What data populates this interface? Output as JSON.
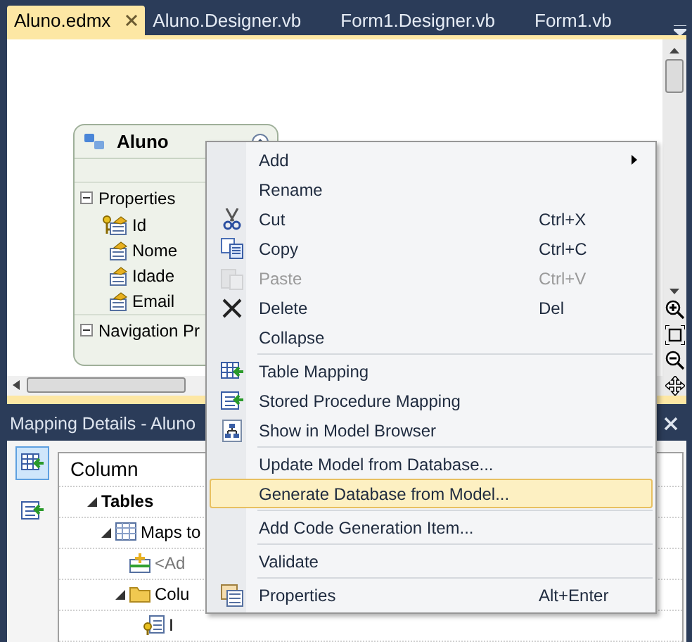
{
  "tabs": [
    {
      "label": "Aluno.edmx",
      "selected": true
    },
    {
      "label": "Aluno.Designer.vb",
      "selected": false
    },
    {
      "label": "Form1.Designer.vb",
      "selected": false
    },
    {
      "label": "Form1.vb",
      "selected": false
    }
  ],
  "entity": {
    "title": "Aluno",
    "sections": [
      {
        "label": "Properties",
        "expanded": true,
        "items": [
          {
            "name": "Id",
            "key": true
          },
          {
            "name": "Nome",
            "key": false
          },
          {
            "name": "Idade",
            "key": false
          },
          {
            "name": "Email",
            "key": false
          }
        ]
      },
      {
        "label": "Navigation Pr",
        "expanded": true
      }
    ]
  },
  "mapping_panel": {
    "title": "Mapping Details - Aluno",
    "tools": [
      {
        "kind": "table",
        "selected": true
      },
      {
        "kind": "procedure",
        "selected": false
      }
    ],
    "column_header": "Column",
    "rows": [
      {
        "label": "Tables",
        "kind": "group",
        "expanded": true,
        "children": [
          {
            "label": "Maps to",
            "kind": "table",
            "expanded": true,
            "children": [
              {
                "label": "<Ad",
                "kind": "add"
              },
              {
                "label": "Colu",
                "kind": "folder",
                "expanded": true,
                "children": [
                  {
                    "label": "I",
                    "kind": "key"
                  }
                ]
              }
            ]
          }
        ]
      }
    ]
  },
  "context_menu": [
    {
      "label": "Add",
      "kind": "plain",
      "submenu": true,
      "disabled": false,
      "selected": false,
      "separator_before": false
    },
    {
      "label": "Rename",
      "kind": "plain",
      "submenu": false,
      "disabled": false,
      "selected": false,
      "separator_before": false
    },
    {
      "label": "Cut",
      "shortcut": "Ctrl+X",
      "kind": "cut",
      "submenu": false,
      "disabled": false,
      "selected": false,
      "separator_before": false
    },
    {
      "label": "Copy",
      "shortcut": "Ctrl+C",
      "kind": "copy",
      "submenu": false,
      "disabled": false,
      "selected": false,
      "separator_before": false
    },
    {
      "label": "Paste",
      "shortcut": "Ctrl+V",
      "kind": "paste",
      "submenu": false,
      "disabled": true,
      "selected": false,
      "separator_before": false
    },
    {
      "label": "Delete",
      "shortcut": "Del",
      "kind": "delete",
      "submenu": false,
      "disabled": false,
      "selected": false,
      "separator_before": false
    },
    {
      "label": "Collapse",
      "kind": "plain",
      "submenu": false,
      "disabled": false,
      "selected": false,
      "separator_before": false
    },
    {
      "label": "Table Mapping",
      "kind": "table",
      "submenu": false,
      "disabled": false,
      "selected": false,
      "separator_before": true
    },
    {
      "label": "Stored Procedure Mapping",
      "kind": "procedure",
      "submenu": false,
      "disabled": false,
      "selected": false,
      "separator_before": false
    },
    {
      "label": "Show in Model Browser",
      "kind": "browser",
      "submenu": false,
      "disabled": false,
      "selected": false,
      "separator_before": false
    },
    {
      "label": "Update Model from Database...",
      "kind": "plain",
      "submenu": false,
      "disabled": false,
      "selected": false,
      "separator_before": true
    },
    {
      "label": "Generate Database from Model...",
      "kind": "plain",
      "submenu": false,
      "disabled": false,
      "selected": true,
      "separator_before": false
    },
    {
      "label": "Add Code Generation Item...",
      "kind": "plain",
      "submenu": false,
      "disabled": false,
      "selected": false,
      "separator_before": true
    },
    {
      "label": "Validate",
      "kind": "plain",
      "submenu": false,
      "disabled": false,
      "selected": false,
      "separator_before": true
    },
    {
      "label": "Properties",
      "shortcut": "Alt+Enter",
      "kind": "properties",
      "submenu": false,
      "disabled": false,
      "selected": false,
      "separator_before": true
    }
  ]
}
